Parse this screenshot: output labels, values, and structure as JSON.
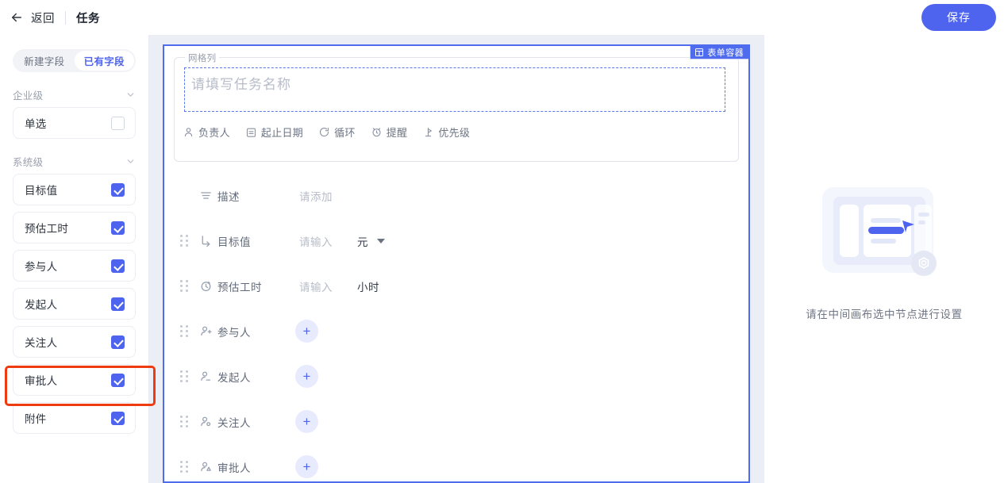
{
  "topbar": {
    "back_label": "返回",
    "page_title": "任务",
    "save_label": "保存"
  },
  "sidebar": {
    "tabs": [
      {
        "label": "新建字段",
        "active": false
      },
      {
        "label": "已有字段",
        "active": true
      }
    ],
    "groups": [
      {
        "title": "企业级",
        "fields": [
          {
            "label": "单选",
            "checked": false
          }
        ]
      },
      {
        "title": "系统级",
        "fields": [
          {
            "label": "目标值",
            "checked": true
          },
          {
            "label": "预估工时",
            "checked": true
          },
          {
            "label": "参与人",
            "checked": true
          },
          {
            "label": "发起人",
            "checked": true
          },
          {
            "label": "关注人",
            "checked": true
          },
          {
            "label": "审批人",
            "checked": true,
            "highlighted": true
          },
          {
            "label": "附件",
            "checked": true
          }
        ]
      }
    ],
    "highlight_color": "#ef3b11"
  },
  "canvas": {
    "selection_color": "#4f6cef",
    "badge_label": "表单容器",
    "grid_legend": "网格列",
    "title_placeholder": "请填写任务名称",
    "chips": [
      {
        "label": "负责人",
        "icon": "person-icon"
      },
      {
        "label": "起止日期",
        "icon": "calendar-icon"
      },
      {
        "label": "循环",
        "icon": "repeat-icon"
      },
      {
        "label": "提醒",
        "icon": "alarm-icon"
      },
      {
        "label": "优先级",
        "icon": "priority-flag-icon"
      }
    ],
    "rows": [
      {
        "icon": "description-icon",
        "label": "描述",
        "value": "请添加",
        "unit": "",
        "draggable": false,
        "control": "text"
      },
      {
        "icon": "target-icon",
        "label": "目标值",
        "value": "请输入",
        "unit": "元",
        "unit_caret": true,
        "draggable": true,
        "control": "text"
      },
      {
        "icon": "stopwatch-icon",
        "label": "预估工时",
        "value": "请输入",
        "unit": "小时",
        "unit_caret": false,
        "draggable": true,
        "control": "text"
      },
      {
        "icon": "person-add-icon",
        "label": "参与人",
        "value": "",
        "unit": "",
        "draggable": true,
        "control": "add"
      },
      {
        "icon": "person-initiator-icon",
        "label": "发起人",
        "value": "",
        "unit": "",
        "draggable": true,
        "control": "add"
      },
      {
        "icon": "person-watch-icon",
        "label": "关注人",
        "value": "",
        "unit": "",
        "draggable": true,
        "control": "add"
      },
      {
        "icon": "person-approve-icon",
        "label": "审批人",
        "value": "",
        "unit": "",
        "draggable": true,
        "control": "add"
      }
    ],
    "add_button_label": "+"
  },
  "right_panel": {
    "empty_text": "请在中间画布选中节点进行设置"
  }
}
